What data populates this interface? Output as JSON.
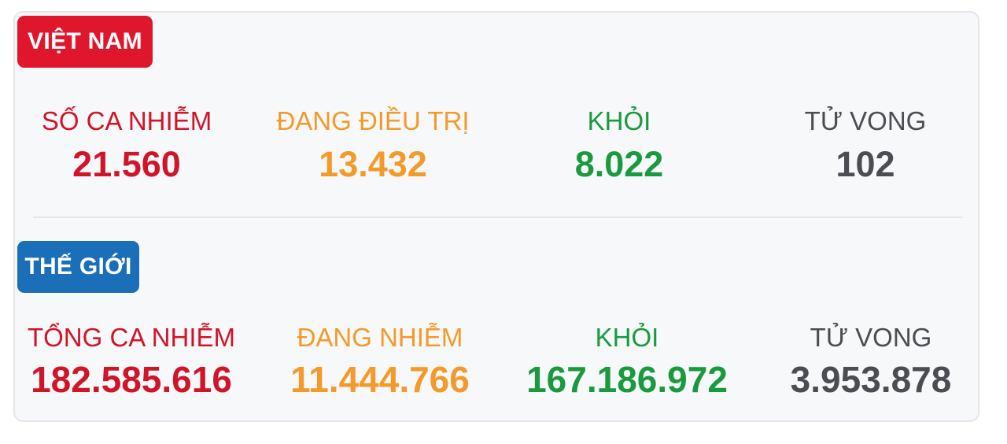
{
  "colors": {
    "red": "#d0152a",
    "orange": "#f39a2b",
    "green": "#1a9a3e",
    "gray": "#4b4d52",
    "vn_badge": "#e0172c",
    "world_badge": "#1a6fb8"
  },
  "vietnam": {
    "badge": "VIỆT NAM",
    "stats": [
      {
        "label": "SỐ CA NHIỄM",
        "value": "21.560",
        "color": "red"
      },
      {
        "label": "ĐANG ĐIỀU TRỊ",
        "value": "13.432",
        "color": "orange"
      },
      {
        "label": "KHỎI",
        "value": "8.022",
        "color": "green"
      },
      {
        "label": "TỬ VONG",
        "value": "102",
        "color": "gray"
      }
    ]
  },
  "world": {
    "badge": "THẾ GIỚI",
    "stats": [
      {
        "label": "TỔNG CA NHIỄM",
        "value": "182.585.616",
        "color": "red"
      },
      {
        "label": "ĐANG NHIỄM",
        "value": "11.444.766",
        "color": "orange"
      },
      {
        "label": "KHỎI",
        "value": "167.186.972",
        "color": "green"
      },
      {
        "label": "TỬ VONG",
        "value": "3.953.878",
        "color": "gray"
      }
    ]
  }
}
